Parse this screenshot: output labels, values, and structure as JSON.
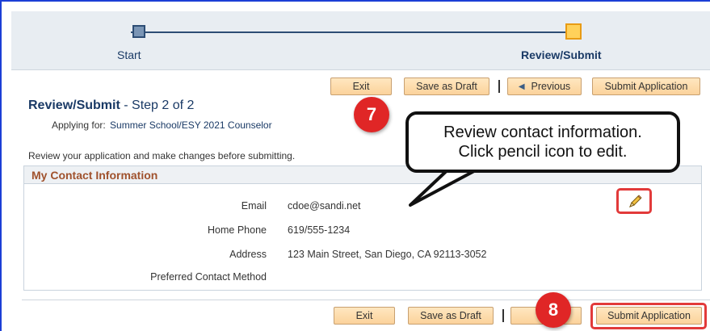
{
  "progress": {
    "steps": [
      {
        "label": "Start"
      },
      {
        "label": "Review/Submit"
      }
    ]
  },
  "toolbar": {
    "exit": "Exit",
    "save_draft": "Save as Draft",
    "previous": "Previous",
    "submit": "Submit Application"
  },
  "header": {
    "title": "Review/Submit",
    "step": " - Step 2 of 2",
    "applying_label": "Applying for:",
    "applying_value": "Summer School/ESY 2021 Counselor",
    "instructions": "Review your application and make changes before submitting."
  },
  "contact": {
    "section_title": "My Contact Information",
    "fields": [
      {
        "label": "Email",
        "value": "cdoe@sandi.net"
      },
      {
        "label": "Home Phone",
        "value": "619/555-1234"
      },
      {
        "label": "Address",
        "value": "123 Main Street, San Diego, CA 92113-3052"
      },
      {
        "label": "Preferred Contact Method",
        "value": ""
      }
    ]
  },
  "callouts": {
    "step7": "7",
    "step8": "8",
    "bubble_line1": "Review contact information.",
    "bubble_line2": "Click pencil icon to edit."
  },
  "icons": {
    "edit": "pencil-icon",
    "prev": "triangle-left-icon"
  },
  "colors": {
    "accent_badge": "#e02626",
    "button_fill": "#fbd29b",
    "section_title": "#a0522d",
    "link_blue": "#1a3a66"
  }
}
